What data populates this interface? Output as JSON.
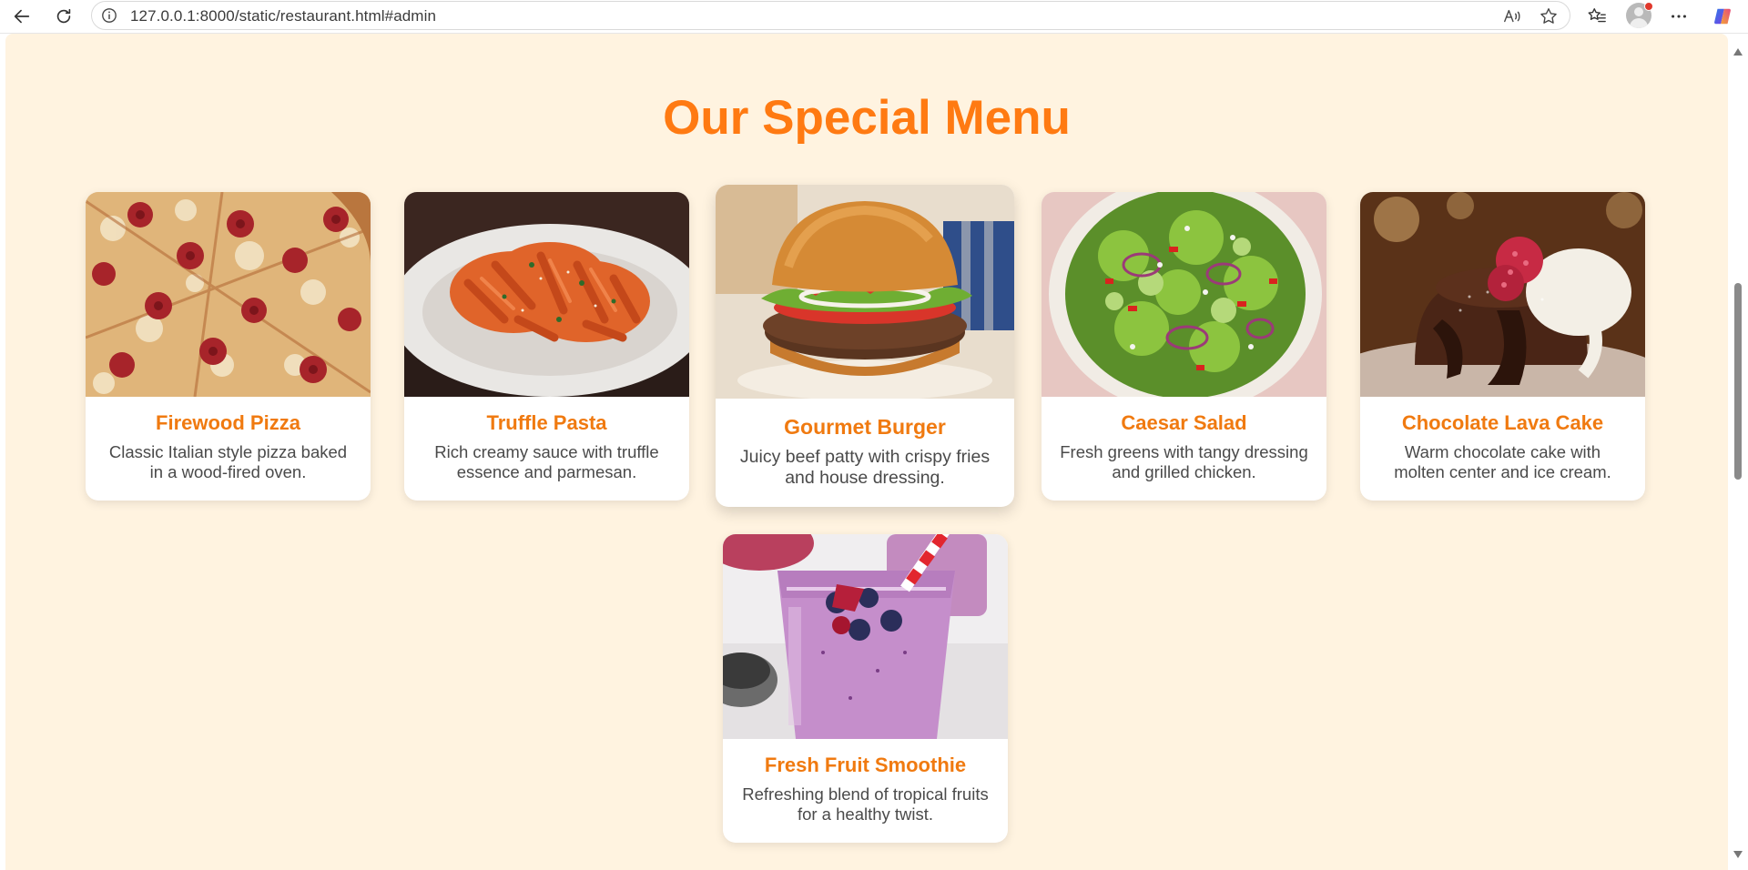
{
  "browser": {
    "url": "127.0.0.1:8000/static/restaurant.html#admin",
    "icons": {
      "back": "back-arrow-icon",
      "reload": "reload-icon",
      "site_info": "info-icon",
      "read_aloud": "read-aloud-icon",
      "favorite": "star-icon",
      "favorites_bar": "favorites-list-icon",
      "profile": "profile-avatar-icon",
      "more": "more-dots-icon",
      "copilot": "copilot-icon"
    }
  },
  "menu": {
    "title": "Our Special Menu",
    "items": [
      {
        "name": "Firewood Pizza",
        "description": "Classic Italian style pizza baked in a wood-fired oven."
      },
      {
        "name": "Truffle Pasta",
        "description": "Rich creamy sauce with truffle essence and parmesan."
      },
      {
        "name": "Gourmet Burger",
        "description": "Juicy beef patty with crispy fries and house dressing."
      },
      {
        "name": "Caesar Salad",
        "description": "Fresh greens with tangy dressing and grilled chicken."
      },
      {
        "name": "Chocolate Lava Cake",
        "description": "Warm chocolate cake with molten center and ice cream."
      },
      {
        "name": "Fresh Fruit Smoothie",
        "description": "Refreshing blend of tropical fruits for a healthy twist."
      }
    ]
  },
  "colors": {
    "accent": "#ff7a12",
    "page_background": "#fff3e0",
    "card_background": "#ffffff",
    "description_text": "#4a4a4a"
  }
}
